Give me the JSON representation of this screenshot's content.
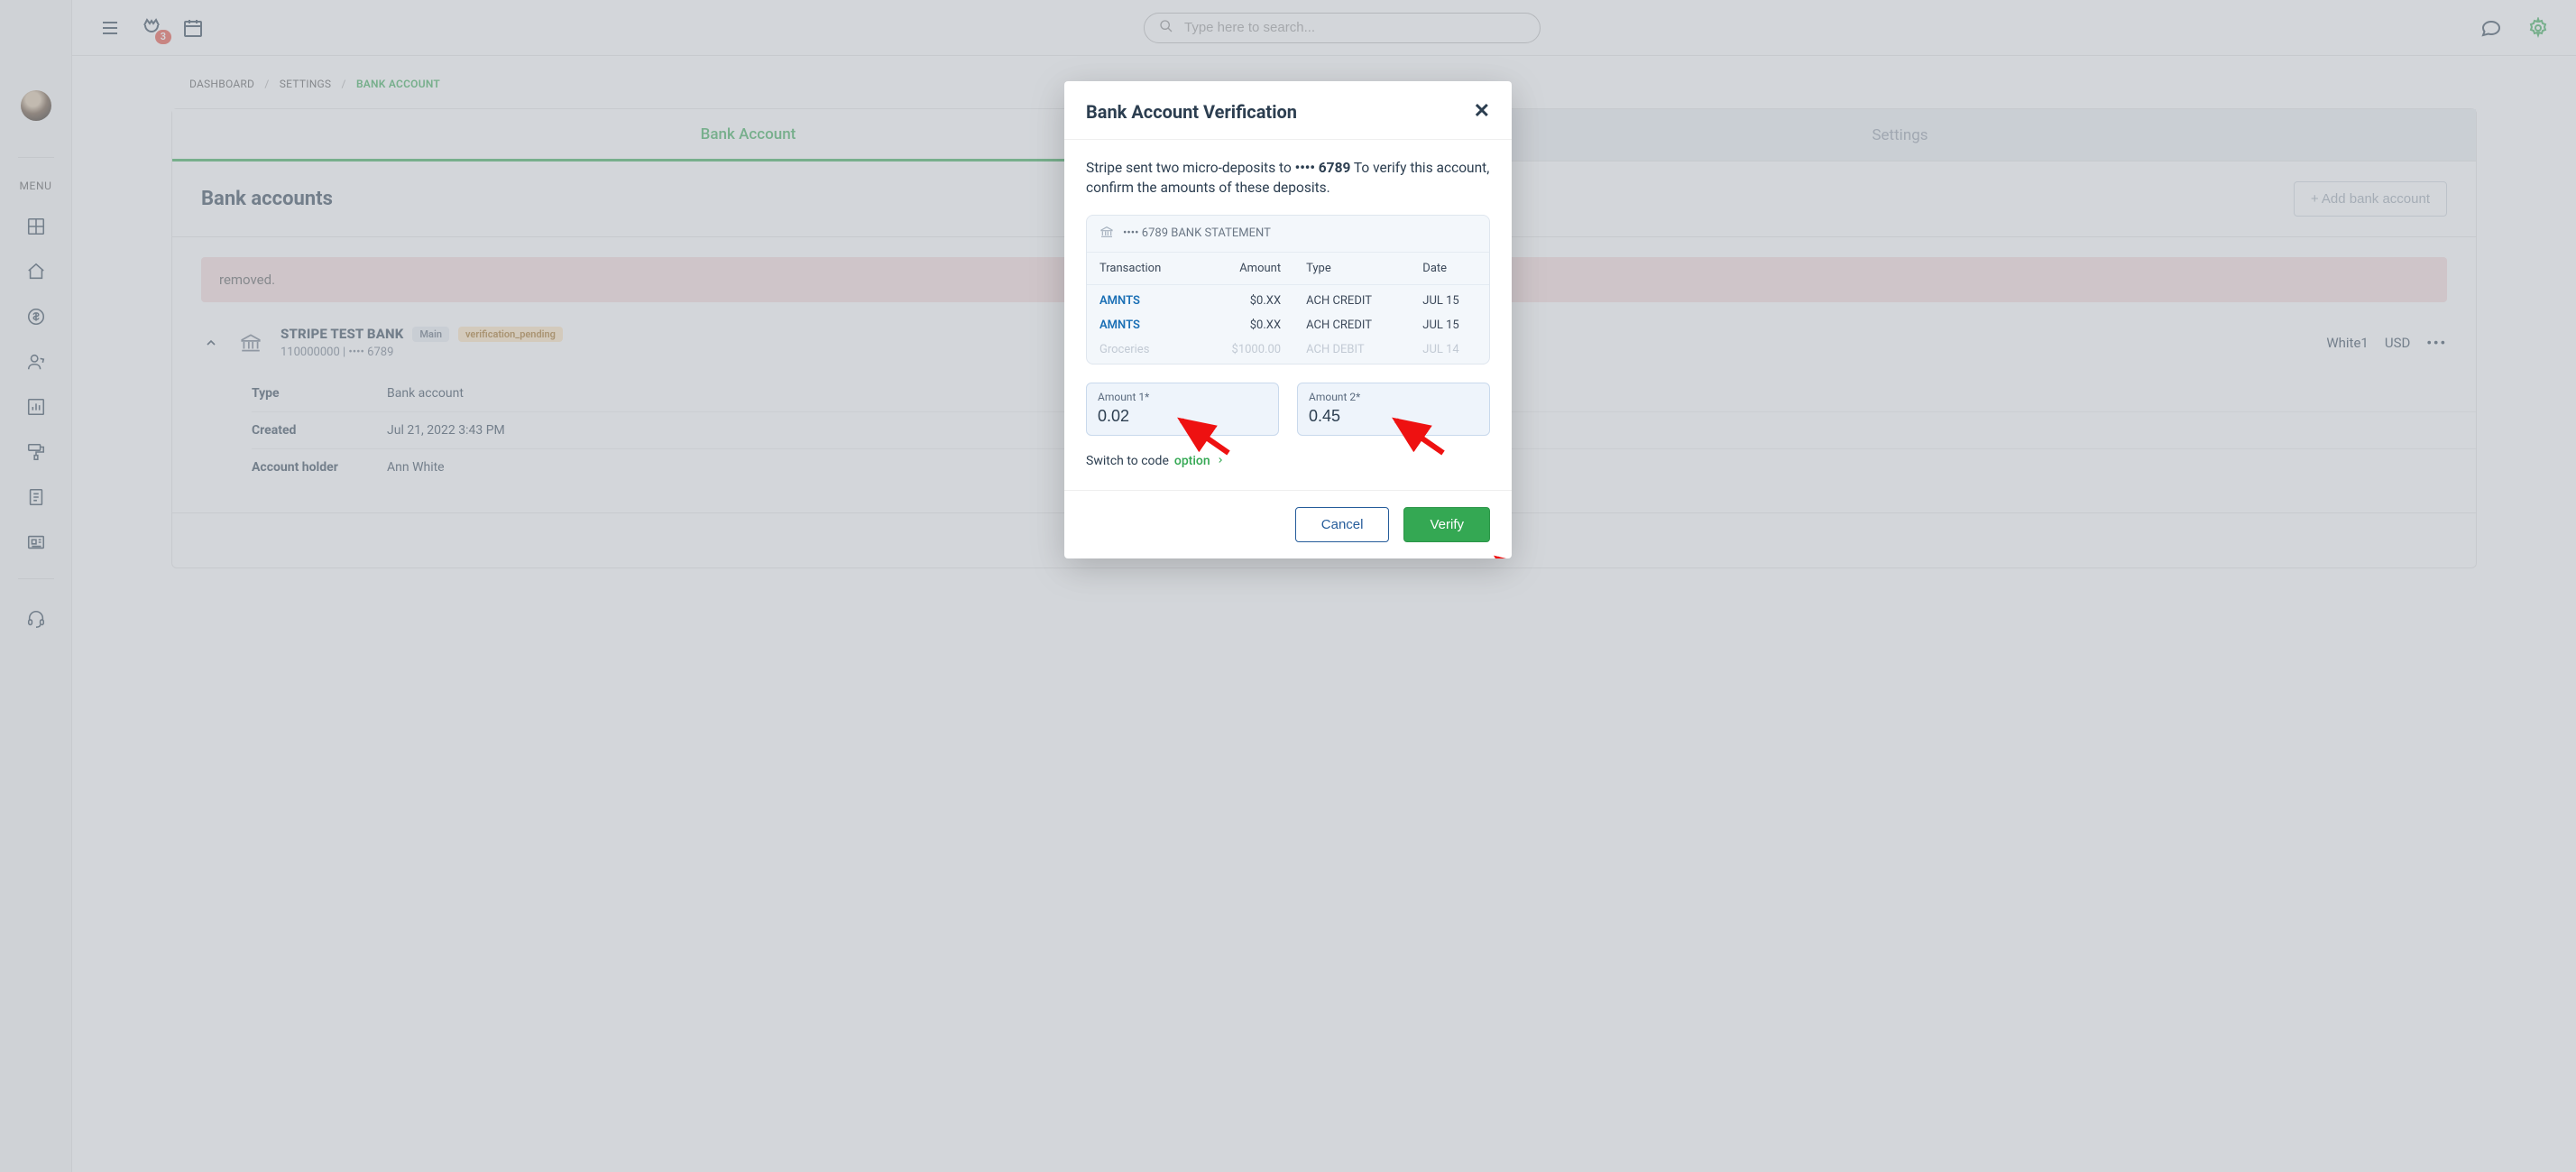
{
  "topbar": {
    "notifications_count": "3",
    "search_placeholder": "Type here to search..."
  },
  "sidebar": {
    "menu_label": "MENU"
  },
  "breadcrumbs": {
    "items": [
      "DASHBOARD",
      "SETTINGS",
      "BANK ACCOUNT"
    ]
  },
  "tabs": {
    "bank": "Bank Account",
    "settings": "Settings"
  },
  "section": {
    "title": "Bank accounts",
    "add_button": "+ Add bank account"
  },
  "alert": {
    "text_suffix": " removed."
  },
  "account": {
    "name": "STRIPE TEST BANK",
    "main_pill": "Main",
    "pending_pill": "verification_pending",
    "routing": "110000000",
    "mask": "•••• 6789",
    "holder_visible": "White1",
    "currency": "USD"
  },
  "details": {
    "type_label": "Type",
    "type_value": "Bank account",
    "created_label": "Created",
    "created_value": "Jul 21, 2022 3:43 PM",
    "holder_label": "Account holder",
    "holder_value": "Ann White"
  },
  "modal": {
    "title": "Bank Account Verification",
    "body_prefix": "Stripe sent two micro-deposits to ",
    "body_mask": "•••• 6789",
    "body_suffix": " To verify this account, confirm the amounts of these deposits.",
    "statement_header": "•••• 6789 BANK STATEMENT",
    "columns": {
      "txn": "Transaction",
      "amount": "Amount",
      "type": "Type",
      "date": "Date"
    },
    "rows": [
      {
        "txn": "AMNTS",
        "amount": "$0.XX",
        "type": "ACH CREDIT",
        "date": "JUL 15"
      },
      {
        "txn": "AMNTS",
        "amount": "$0.XX",
        "type": "ACH CREDIT",
        "date": "JUL 15"
      },
      {
        "txn": "Groceries",
        "amount": "$1000.00",
        "type": "ACH DEBIT",
        "date": "JUL 14"
      }
    ],
    "amount1_label": "Amount 1*",
    "amount1_value": "0.02",
    "amount2_label": "Amount 2*",
    "amount2_value": "0.45",
    "switch_prefix": "Switch to code ",
    "switch_option": "option",
    "cancel": "Cancel",
    "verify": "Verify"
  }
}
